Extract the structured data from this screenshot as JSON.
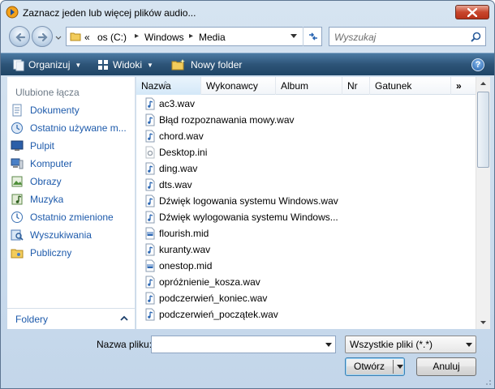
{
  "window": {
    "title": "Zaznacz jeden lub więcej plików audio..."
  },
  "address": {
    "overflow": "«",
    "crumbs": [
      "os (C:)",
      "Windows",
      "Media"
    ]
  },
  "search": {
    "placeholder": "Wyszukaj"
  },
  "toolbar": {
    "organize": "Organizuj",
    "views": "Widoki",
    "new_folder": "Nowy folder",
    "help": "?"
  },
  "nav": {
    "header": "Ulubione łącza",
    "items": [
      {
        "label": "Dokumenty",
        "icon": "documents-icon"
      },
      {
        "label": "Ostatnio używane m...",
        "icon": "recent-places-icon"
      },
      {
        "label": "Pulpit",
        "icon": "desktop-icon"
      },
      {
        "label": "Komputer",
        "icon": "computer-icon"
      },
      {
        "label": "Obrazy",
        "icon": "pictures-icon"
      },
      {
        "label": "Muzyka",
        "icon": "music-icon"
      },
      {
        "label": "Ostatnio zmienione",
        "icon": "recently-changed-icon"
      },
      {
        "label": "Wyszukiwania",
        "icon": "searches-icon"
      },
      {
        "label": "Publiczny",
        "icon": "public-folder-icon"
      }
    ],
    "folders_label": "Foldery"
  },
  "columns": [
    "Nazwa",
    "Wykonawcy",
    "Album",
    "Nr",
    "Gatunek",
    "»"
  ],
  "files": [
    {
      "name": "ac3.wav",
      "type": "audio"
    },
    {
      "name": "Błąd rozpoznawania mowy.wav",
      "type": "audio"
    },
    {
      "name": "chord.wav",
      "type": "audio"
    },
    {
      "name": "Desktop.ini",
      "type": "settings"
    },
    {
      "name": "ding.wav",
      "type": "audio"
    },
    {
      "name": "dts.wav",
      "type": "audio"
    },
    {
      "name": "Dźwięk logowania systemu Windows.wav",
      "type": "audio"
    },
    {
      "name": "Dźwięk wylogowania systemu Windows...",
      "type": "audio"
    },
    {
      "name": "flourish.mid",
      "type": "midi"
    },
    {
      "name": "kuranty.wav",
      "type": "audio"
    },
    {
      "name": "onestop.mid",
      "type": "midi"
    },
    {
      "name": "opróżnienie_kosza.wav",
      "type": "audio"
    },
    {
      "name": "podczerwień_koniec.wav",
      "type": "audio"
    },
    {
      "name": "podczerwień_początek.wav",
      "type": "audio"
    }
  ],
  "bottom": {
    "filename_label": "Nazwa pliku:",
    "filename_value": "",
    "filetype": "Wszystkie pliki (*.*)",
    "open": "Otwórz",
    "cancel": "Anuluj"
  },
  "colors": {
    "link": "#1d5aab",
    "toolbar": "#2d5478",
    "close": "#c8462c"
  }
}
